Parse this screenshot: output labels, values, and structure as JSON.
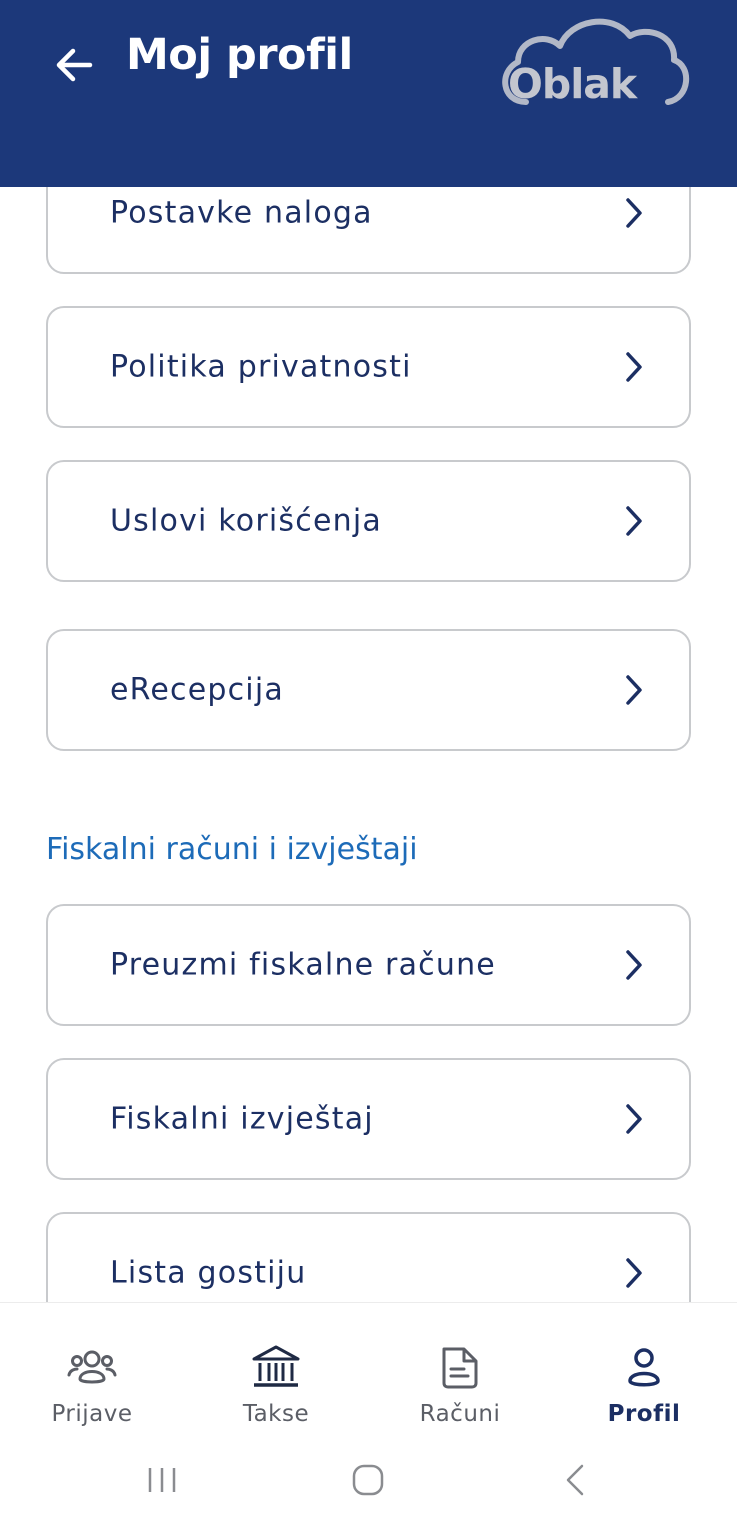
{
  "header": {
    "title": "Moj profil",
    "logo_text": "Oblak",
    "background_color": "#1c387a"
  },
  "menu": {
    "items": [
      {
        "label": "Postavke naloga"
      },
      {
        "label": "Politika privatnosti"
      },
      {
        "label": "Uslovi korišćenja"
      },
      {
        "label": "eRecepcija"
      }
    ]
  },
  "fiscal_section": {
    "title": "Fiskalni računi i izvještaji",
    "items": [
      {
        "label": "Preuzmi fiskalne račune"
      },
      {
        "label": "Fiskalni izvještaj"
      },
      {
        "label": "Lista gostiju"
      }
    ]
  },
  "bottom_nav": {
    "items": [
      {
        "label": "Prijave",
        "icon": "users-icon"
      },
      {
        "label": "Takse",
        "icon": "bank-icon"
      },
      {
        "label": "Računi",
        "icon": "document-icon"
      },
      {
        "label": "Profil",
        "icon": "user-icon",
        "active": true
      }
    ],
    "active_color": "#a9e4f7"
  },
  "system_nav": {
    "buttons": [
      "recent-apps",
      "home",
      "back"
    ]
  }
}
